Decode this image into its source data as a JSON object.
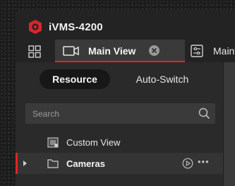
{
  "app": {
    "title": "iVMS-4200"
  },
  "tabs": {
    "main_view": "Main View",
    "maintenance": "Mainter"
  },
  "resource_panel": {
    "segments": {
      "resource": "Resource",
      "auto_switch": "Auto-Switch"
    },
    "search": {
      "placeholder": "Search",
      "value": ""
    },
    "tree": [
      {
        "label": "Custom View",
        "icon": "custom-view-icon",
        "selected": false
      },
      {
        "label": "Cameras",
        "icon": "folder-icon",
        "selected": true
      }
    ]
  },
  "colors": {
    "accent": "#e0242b",
    "title_bg": "#232323",
    "panel_bg": "#2a2a2a",
    "active_tab_bg": "#3a3a3a",
    "segment_active_bg": "#171717"
  }
}
